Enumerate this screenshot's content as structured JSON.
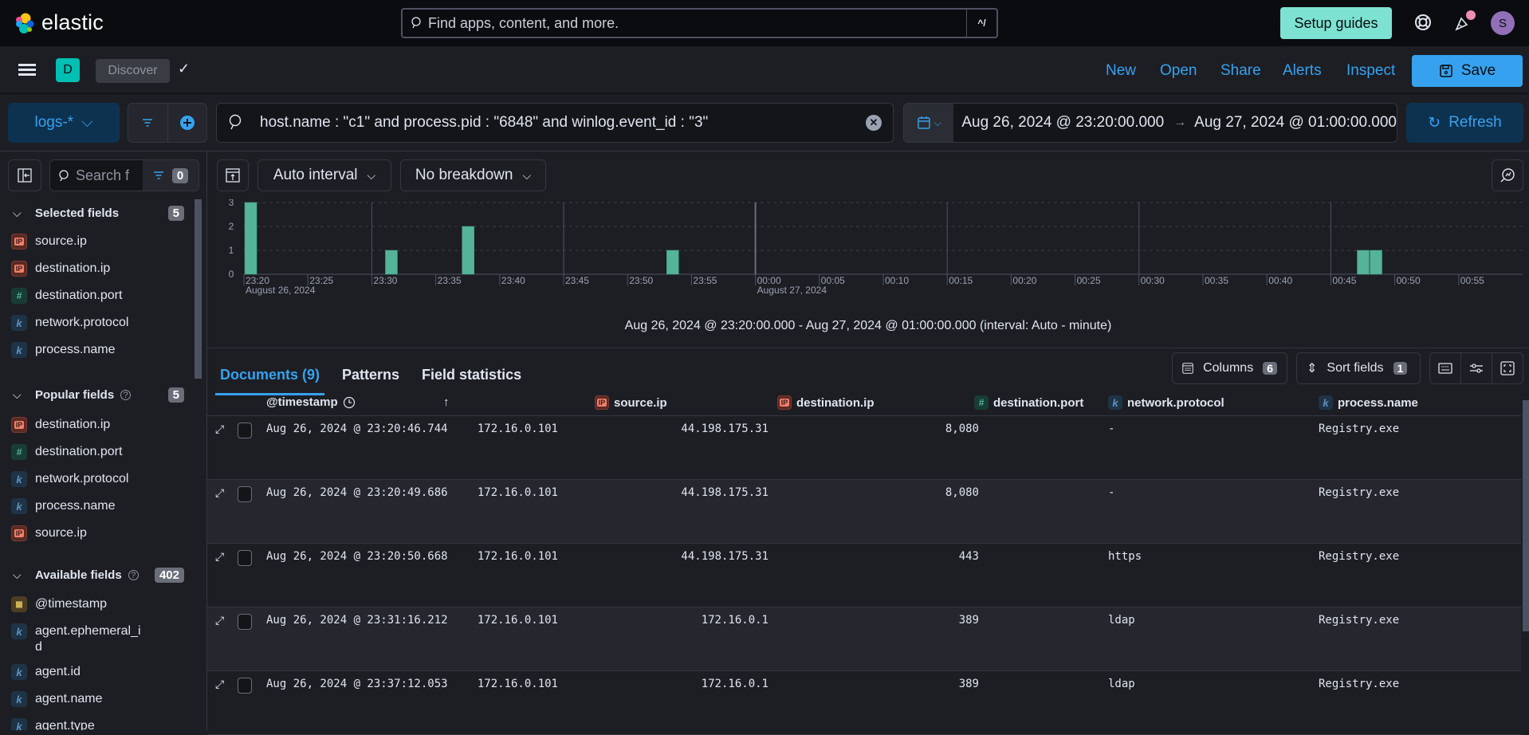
{
  "topbar": {
    "logo_text": "elastic",
    "search_placeholder": "Find apps, content, and more.",
    "search_shortcut": "^/",
    "setup_guides_label": "Setup guides",
    "avatar_initial": "S"
  },
  "appbar": {
    "space_initial": "D",
    "breadcrumb": "Discover",
    "links": [
      "New",
      "Open",
      "Share",
      "Alerts",
      "Inspect"
    ],
    "save_label": "Save"
  },
  "querybar": {
    "data_view": "logs-*",
    "query": "host.name : \"c1\" and process.pid : \"6848\" and winlog.event_id : \"3\"",
    "date_start": "Aug 26, 2024 @ 23:20:00.000",
    "date_end": "Aug 27, 2024 @ 01:00:00.000",
    "refresh_label": "Refresh"
  },
  "sidebar": {
    "search_placeholder": "Search f",
    "filter_count": "0",
    "sections": [
      {
        "title": "Selected fields",
        "count": "5",
        "help": false,
        "fields": [
          {
            "name": "source.ip",
            "type": "ip"
          },
          {
            "name": "destination.ip",
            "type": "ip"
          },
          {
            "name": "destination.port",
            "type": "num"
          },
          {
            "name": "network.protocol",
            "type": "kw"
          },
          {
            "name": "process.name",
            "type": "kw"
          }
        ]
      },
      {
        "title": "Popular fields",
        "count": "5",
        "help": true,
        "fields": [
          {
            "name": "destination.ip",
            "type": "ip"
          },
          {
            "name": "destination.port",
            "type": "num"
          },
          {
            "name": "network.protocol",
            "type": "kw"
          },
          {
            "name": "process.name",
            "type": "kw"
          },
          {
            "name": "source.ip",
            "type": "ip"
          }
        ]
      },
      {
        "title": "Available fields",
        "count": "402",
        "help": true,
        "fields": [
          {
            "name": "@timestamp",
            "type": "date"
          },
          {
            "name": "agent.ephemeral_id",
            "type": "kw"
          },
          {
            "name": "agent.id",
            "type": "kw"
          },
          {
            "name": "agent.name",
            "type": "kw"
          },
          {
            "name": "agent.type",
            "type": "kw"
          }
        ]
      }
    ]
  },
  "histogram_toolbar": {
    "interval_label": "Auto interval",
    "breakdown_label": "No breakdown"
  },
  "chart_data": {
    "type": "bar",
    "title": "",
    "xlabel": "",
    "ylabel": "",
    "ylim": [
      0,
      3
    ],
    "yticks": [
      "0",
      "1",
      "2",
      "3"
    ],
    "x_range": [
      "23:20",
      "01:00"
    ],
    "xticks": [
      "23:20",
      "23:25",
      "23:30",
      "23:35",
      "23:40",
      "23:45",
      "23:50",
      "23:55",
      "00:00",
      "00:05",
      "00:10",
      "00:15",
      "00:20",
      "00:25",
      "00:30",
      "00:35",
      "00:40",
      "00:45",
      "00:50",
      "00:55"
    ],
    "date_labels": [
      {
        "at": "23:20",
        "text": "August 26, 2024"
      },
      {
        "at": "00:00",
        "text": "August 27, 2024"
      }
    ],
    "bar_minutes": [
      "23:20",
      "23:31",
      "23:37",
      "23:53",
      "00:47",
      "00:48"
    ],
    "values": [
      3,
      1,
      2,
      1,
      1,
      1
    ],
    "color": "#54b399",
    "grid": true
  },
  "histogram_caption": "Aug 26, 2024 @ 23:20:00.000 - Aug 27, 2024 @ 01:00:00.000 (interval: Auto - minute)",
  "tabs": [
    {
      "label": "Documents (9)",
      "active": true
    },
    {
      "label": "Patterns",
      "active": false
    },
    {
      "label": "Field statistics",
      "active": false
    }
  ],
  "grid_tools": {
    "columns_label": "Columns",
    "columns_count": "6",
    "sort_label": "Sort fields",
    "sort_count": "1"
  },
  "table": {
    "columns": [
      {
        "name": "@timestamp",
        "type": ""
      },
      {
        "name": "source.ip",
        "type": "ip"
      },
      {
        "name": "destination.ip",
        "type": "ip"
      },
      {
        "name": "destination.port",
        "type": "num"
      },
      {
        "name": "network.protocol",
        "type": "kw"
      },
      {
        "name": "process.name",
        "type": "kw"
      }
    ],
    "rows": [
      {
        "timestamp": "Aug 26, 2024 @ 23:20:46.744",
        "source_ip": "172.16.0.101",
        "destination_ip": "44.198.175.31",
        "destination_port": "8,080",
        "network_protocol": "-",
        "process_name": "Registry.exe"
      },
      {
        "timestamp": "Aug 26, 2024 @ 23:20:49.686",
        "source_ip": "172.16.0.101",
        "destination_ip": "44.198.175.31",
        "destination_port": "8,080",
        "network_protocol": "-",
        "process_name": "Registry.exe"
      },
      {
        "timestamp": "Aug 26, 2024 @ 23:20:50.668",
        "source_ip": "172.16.0.101",
        "destination_ip": "44.198.175.31",
        "destination_port": "443",
        "network_protocol": "https",
        "process_name": "Registry.exe"
      },
      {
        "timestamp": "Aug 26, 2024 @ 23:31:16.212",
        "source_ip": "172.16.0.101",
        "destination_ip": "172.16.0.1",
        "destination_port": "389",
        "network_protocol": "ldap",
        "process_name": "Registry.exe"
      },
      {
        "timestamp": "Aug 26, 2024 @ 23:37:12.053",
        "source_ip": "172.16.0.101",
        "destination_ip": "172.16.0.1",
        "destination_port": "389",
        "network_protocol": "ldap",
        "process_name": "Registry.exe"
      }
    ]
  }
}
